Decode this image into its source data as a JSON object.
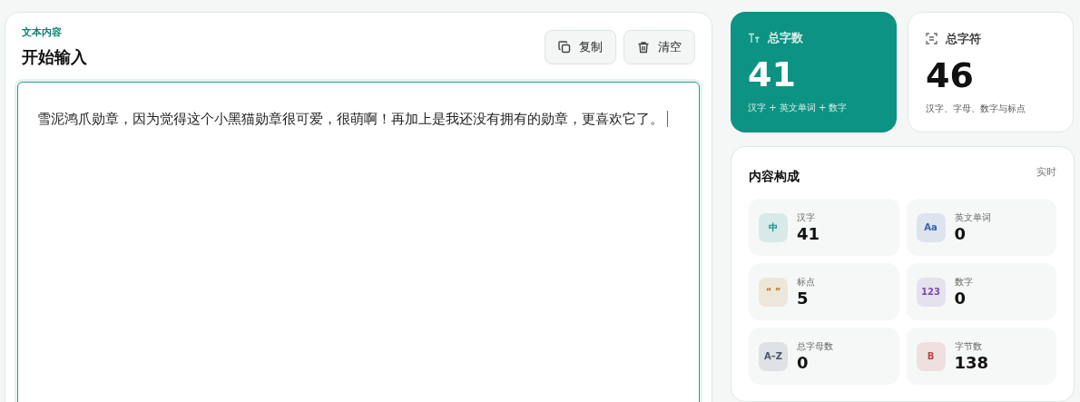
{
  "editor": {
    "eyebrow": "文本内容",
    "title": "开始输入",
    "buttons": [
      {
        "kind": "copy",
        "label": "复制"
      },
      {
        "kind": "clear",
        "label": "清空"
      }
    ],
    "value": "雪泥鸿爪勋章，因为觉得这个小黑猫勋章很可爱，很萌啊！再加上是我还没有拥有的勋章，更喜欢它了。",
    "focused": true
  },
  "stats": [
    {
      "kind": "primary",
      "label": "总字数",
      "value": "41",
      "caption": "汉字 + 英文单词 + 数字"
    },
    {
      "kind": "secondary",
      "label": "总字符",
      "value": "46",
      "caption": "汉字、字母、数字与标点"
    }
  ],
  "composition": {
    "title": "内容构成",
    "badge": "实时",
    "items": [
      {
        "glyph": "中",
        "label": "汉字",
        "value": "41",
        "color": "#0d8f7f"
      },
      {
        "glyph": "Aa",
        "label": "英文单词",
        "value": "0",
        "color": "#3a5fb0"
      },
      {
        "glyph": "“ ”",
        "label": "标点",
        "value": "5",
        "color": "#b7791f"
      },
      {
        "glyph": "123",
        "label": "数字",
        "value": "0",
        "color": "#7b4bb0"
      },
      {
        "glyph": "A–Z",
        "label": "总字母数",
        "value": "0",
        "color": "#475569"
      },
      {
        "glyph": "B",
        "label": "字节数",
        "value": "138",
        "color": "#b5463a"
      }
    ]
  }
}
